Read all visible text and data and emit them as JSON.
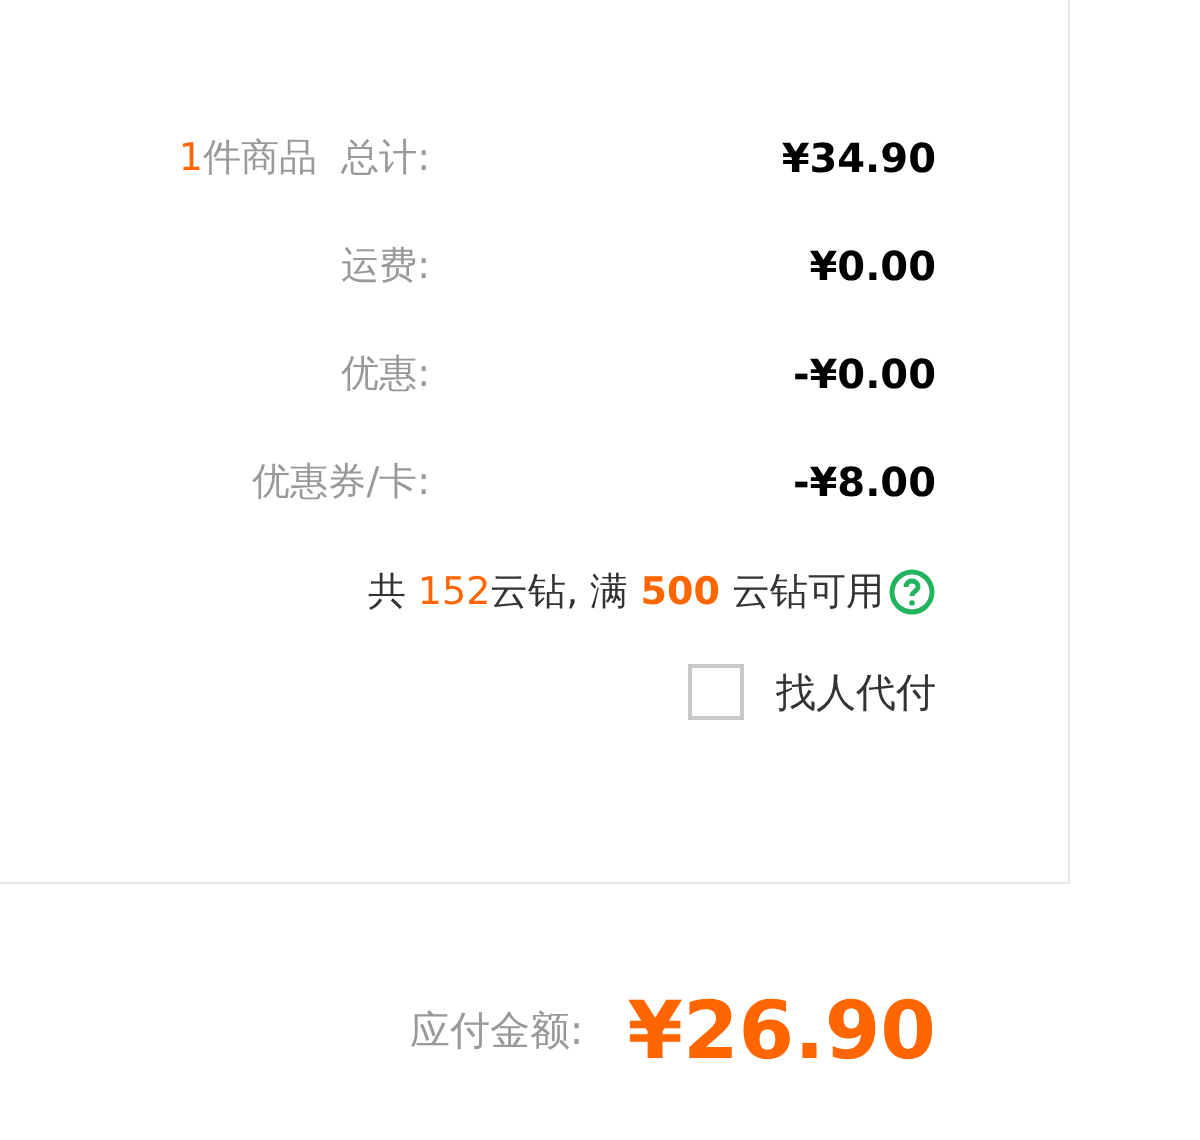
{
  "summary": {
    "item_count": "1",
    "rows": [
      {
        "label": "件商品  总计:",
        "value": "¥34.90"
      },
      {
        "label": "运费:",
        "value": "¥0.00"
      },
      {
        "label": "优惠:",
        "value": "-¥0.00"
      },
      {
        "label": "优惠券/卡:",
        "value": "-¥8.00"
      }
    ]
  },
  "points_note": {
    "parts": [
      {
        "text": "共 ",
        "kind": "plain"
      },
      {
        "text": "152",
        "kind": "count"
      },
      {
        "text": "云钻, 满 ",
        "kind": "plain"
      },
      {
        "text": "500",
        "kind": "threshold"
      },
      {
        "text": " 云钻可用",
        "kind": "plain"
      }
    ]
  },
  "pay_for_me": {
    "label": "找人代付",
    "checked": false
  },
  "total": {
    "label": "应付金额:",
    "value": "¥26.90"
  }
}
